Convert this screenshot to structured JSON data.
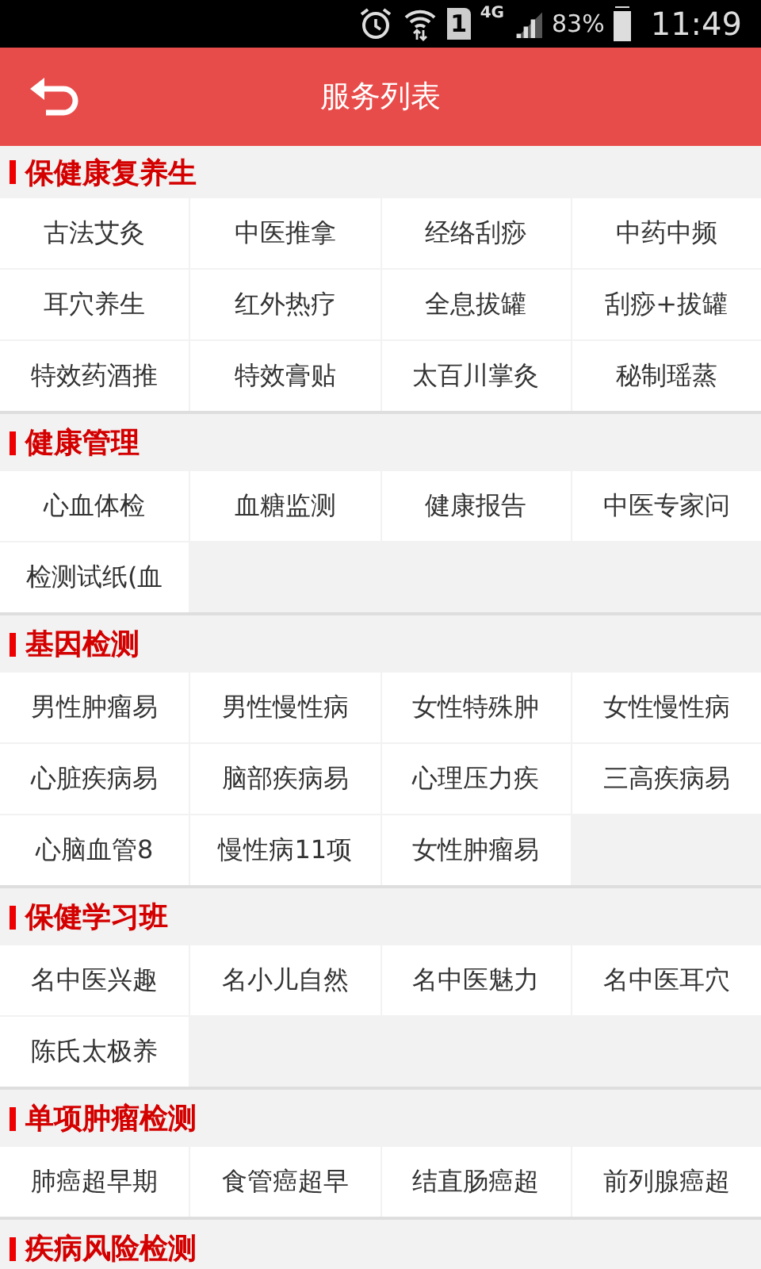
{
  "status_bar": {
    "sim_slot": "1",
    "network": "4G",
    "battery": "83%",
    "time": "11:49"
  },
  "header": {
    "title": "服务列表"
  },
  "sections": [
    {
      "title": "保健康复养生",
      "items": [
        "古法艾灸",
        "中医推拿",
        "经络刮痧",
        "中药中频",
        "耳穴养生",
        "红外热疗",
        "全息拔罐",
        "刮痧+拔罐",
        "特效药酒推",
        "特效膏贴",
        "太百川掌灸",
        "秘制瑶蒸"
      ]
    },
    {
      "title": "健康管理",
      "items": [
        "心血体检",
        "血糖监测",
        "健康报告",
        "中医专家问",
        "检测试纸(血"
      ]
    },
    {
      "title": "基因检测",
      "items": [
        "男性肿瘤易",
        "男性慢性病",
        "女性特殊肿",
        "女性慢性病",
        "心脏疾病易",
        "脑部疾病易",
        "心理压力疾",
        "三高疾病易",
        "心脑血管8",
        "慢性病11项",
        "女性肿瘤易"
      ]
    },
    {
      "title": "保健学习班",
      "items": [
        "名中医兴趣",
        "名小儿自然",
        "名中医魅力",
        "名中医耳穴",
        "陈氏太极养"
      ]
    },
    {
      "title": "单项肿瘤检测",
      "items": [
        "肺癌超早期",
        "食管癌超早",
        "结直肠癌超",
        "前列腺癌超"
      ]
    },
    {
      "title": "疾病风险检测"
    }
  ]
}
